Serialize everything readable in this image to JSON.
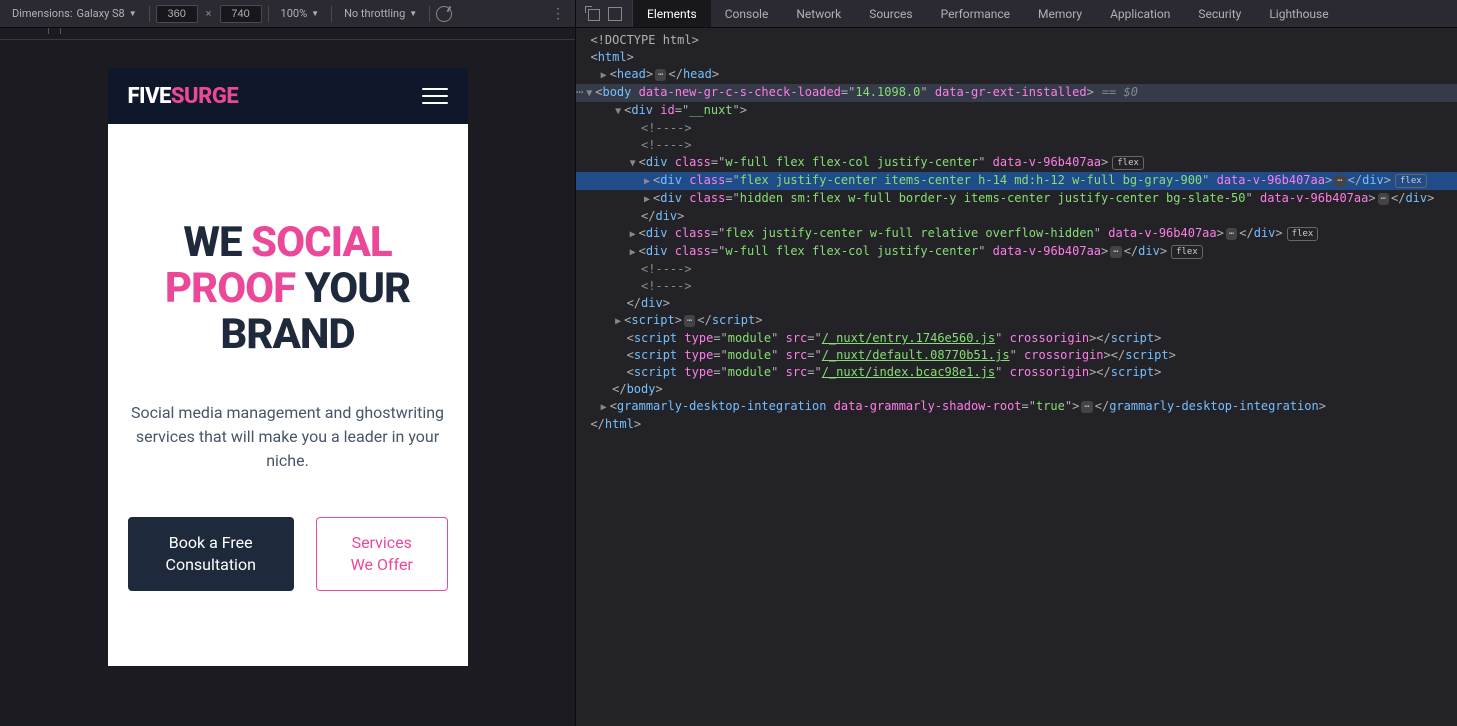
{
  "device_toolbar": {
    "dimensions_label": "Dimensions:",
    "device_name": "Galaxy S8",
    "width": "360",
    "height": "740",
    "zoom": "100%",
    "throttling": "No throttling"
  },
  "site": {
    "logo_part1": "FIVE",
    "logo_part2": "SURGE",
    "hero_we": "WE ",
    "hero_social_proof": "SOCIAL PROOF",
    "hero_your_brand": " YOUR BRAND",
    "subtitle": "Social media management and ghostwriting services that will make you a leader in your niche.",
    "btn_primary": "Book a Free Consultation",
    "btn_secondary": "Services We Offer"
  },
  "devtools": {
    "tabs": [
      "Elements",
      "Console",
      "Network",
      "Sources",
      "Performance",
      "Memory",
      "Application",
      "Security",
      "Lighthouse"
    ],
    "active_tab": "Elements"
  },
  "dom": {
    "doctype": "<!DOCTYPE html>",
    "html_open": "html",
    "head": "head",
    "body_attrs": {
      "attr1_name": "data-new-gr-c-s-check-loaded",
      "attr1_val": "14.1098.0",
      "attr2_name": "data-gr-ext-installed"
    },
    "eq0": "== $0",
    "nuxt_id": "__nuxt",
    "comment": "<!---->",
    "class_flexcol": "w-full flex flex-col justify-center",
    "datav": "data-v-96b407aa",
    "class_header": "flex justify-center items-center h-14 md:h-12 w-full bg-gray-900",
    "class_hidden": "hidden sm:flex w-full border-y items-center justify-center bg-slate-50",
    "class_overflow": "flex justify-center w-full relative overflow-hidden",
    "script_type": "module",
    "crossorigin": "crossorigin",
    "script1_src": "/_nuxt/entry.1746e560.js",
    "script2_src": "/_nuxt/default.08770b51.js",
    "script3_src": "/_nuxt/index.bcac98e1.js",
    "grammarly_tag": "grammarly-desktop-integration",
    "grammarly_attr": "data-grammarly-shadow-root",
    "grammarly_val": "true",
    "flex_badge": "flex",
    "div": "div",
    "script": "script",
    "body": "body",
    "id_attr": "id",
    "class_attr": "class",
    "type_attr": "type",
    "src_attr": "src"
  }
}
